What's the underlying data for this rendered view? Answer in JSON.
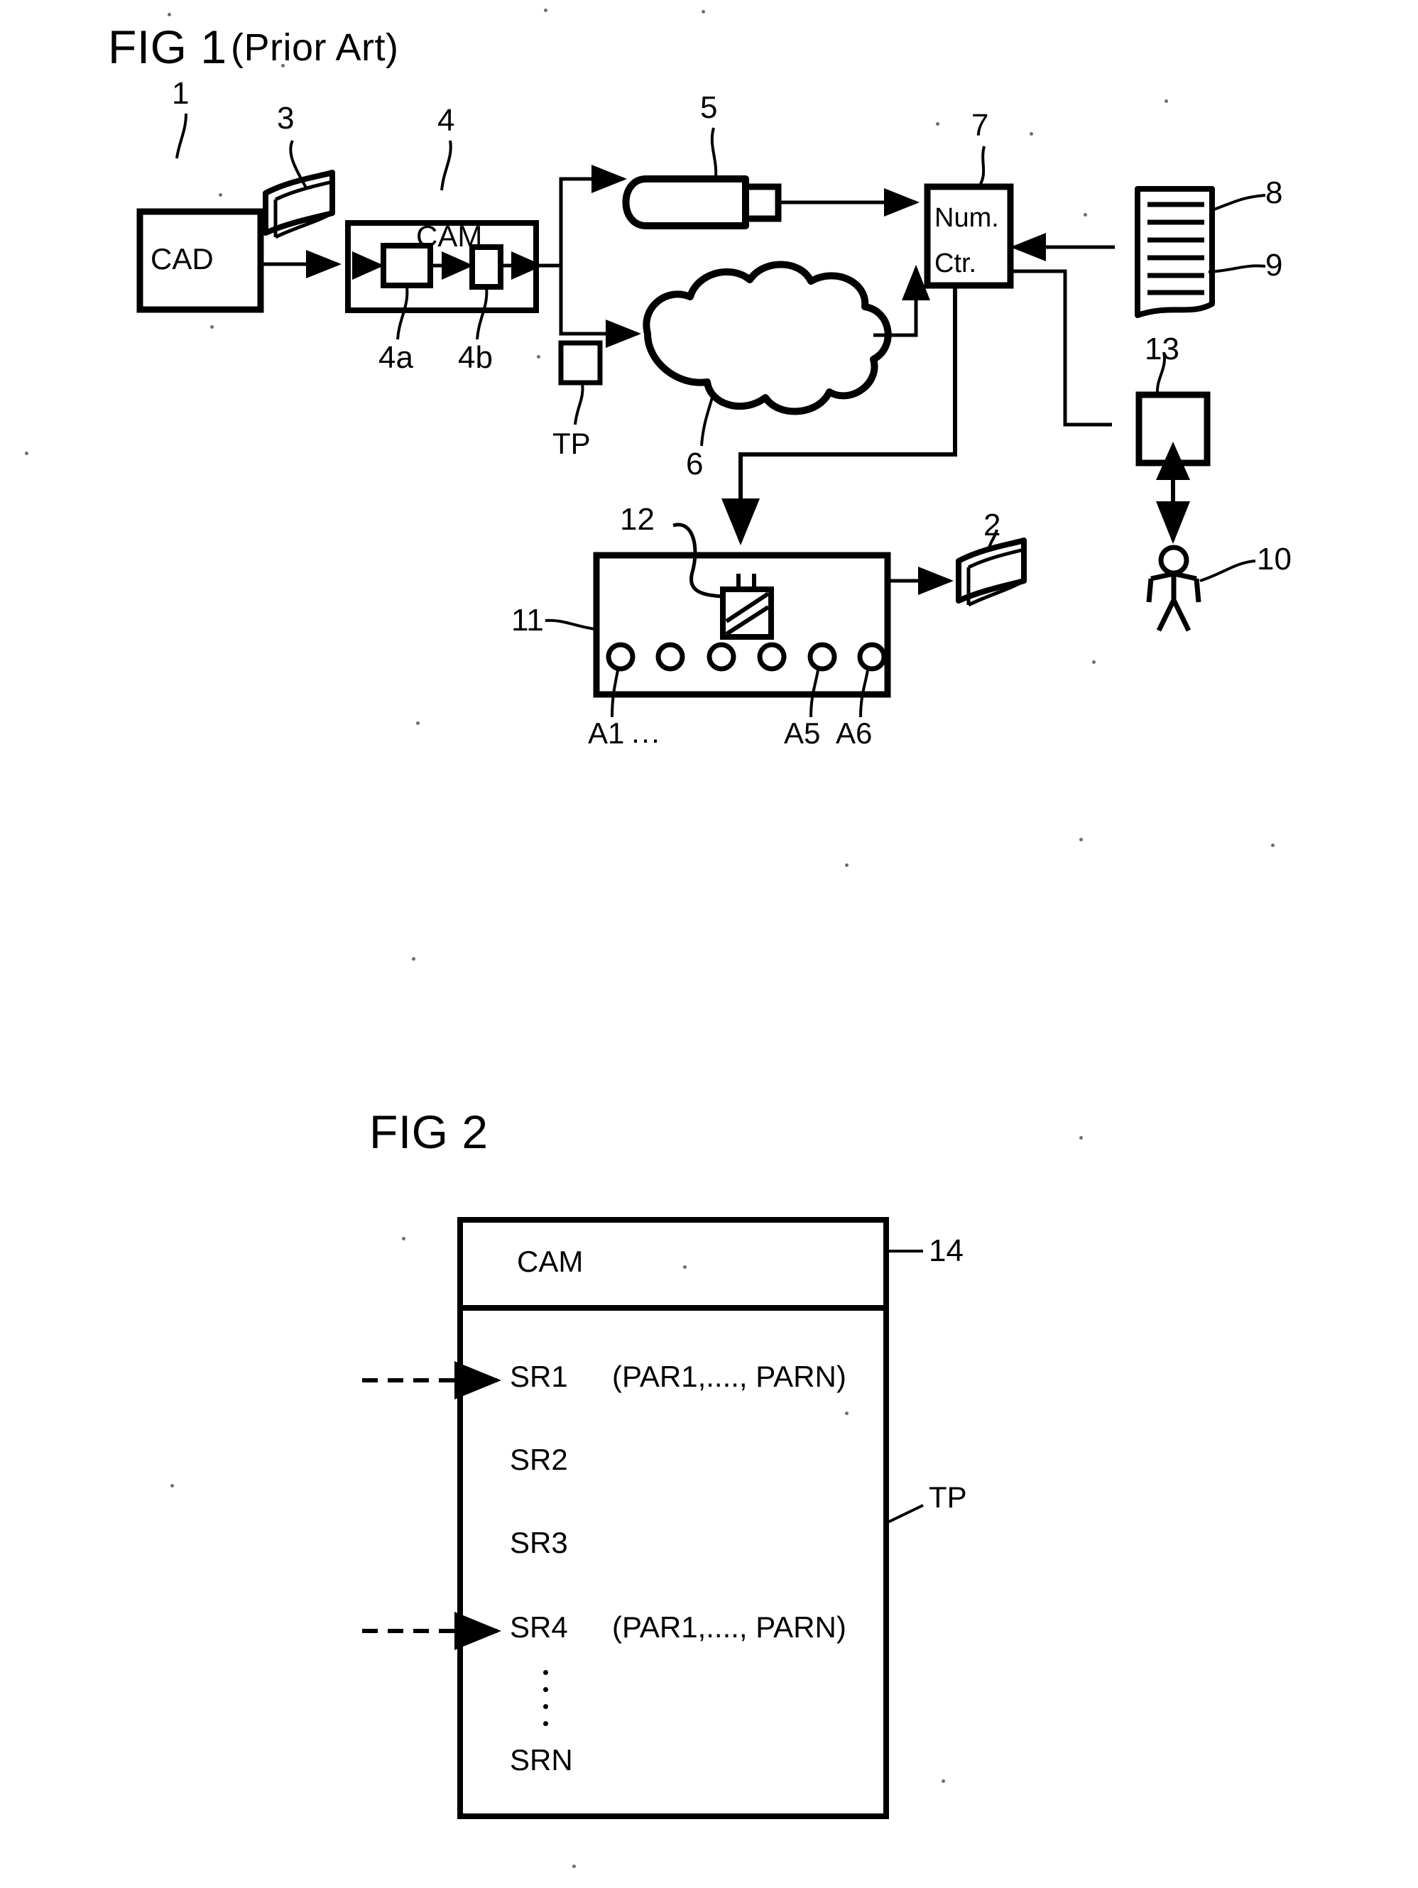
{
  "figures": {
    "fig1": {
      "title": "FIG 1",
      "subtitle": "(Prior Art)",
      "nodes": {
        "cad": "CAD",
        "cam": "CAM",
        "num_ctr_line1": "Num.",
        "num_ctr_line2": "Ctr."
      },
      "reference_numerals": {
        "n1": "1",
        "n3": "3",
        "n4": "4",
        "n4a": "4a",
        "n4b": "4b",
        "n5": "5",
        "n6": "6",
        "n7": "7",
        "n8": "8",
        "n9": "9",
        "n10": "10",
        "n11": "11",
        "n12": "12",
        "n13": "13",
        "n2": "2"
      },
      "labels": {
        "tp": "TP",
        "a1": "A1",
        "a1_dots": "···",
        "a5": "A5",
        "a6": "A6"
      }
    },
    "fig2": {
      "title": "FIG 2",
      "header": "CAM",
      "reference_numerals": {
        "n14": "14"
      },
      "labels": {
        "tp": "TP",
        "vertical_ellipsis": "·"
      },
      "rows": [
        {
          "name": "SR1",
          "params": "(PAR1,...., PARN)",
          "has_arrow": true
        },
        {
          "name": "SR2",
          "params": "",
          "has_arrow": false
        },
        {
          "name": "SR3",
          "params": "",
          "has_arrow": false
        },
        {
          "name": "SR4",
          "params": "(PAR1,...., PARN)",
          "has_arrow": true
        },
        {
          "name": "SRN",
          "params": "",
          "has_arrow": false
        }
      ]
    }
  },
  "colors": {
    "ink": "#000000",
    "paper": "#ffffff",
    "speck": "#6e6e6e"
  }
}
